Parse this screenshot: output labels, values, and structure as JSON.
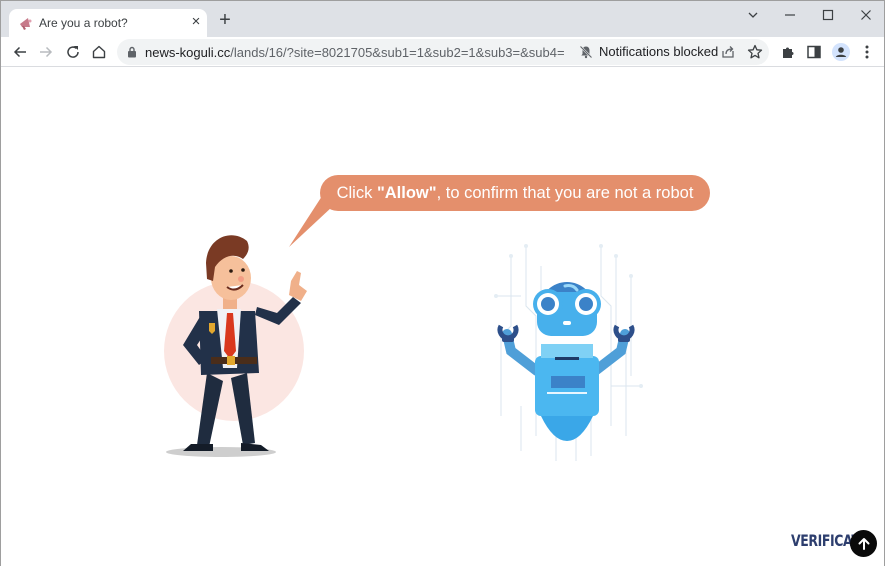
{
  "browser": {
    "tab": {
      "title": "Are you a robot?",
      "favicon": "megaphone-icon",
      "close_label": "×"
    },
    "new_tab_label": "+",
    "window_controls": {
      "tab_search": "⌄",
      "minimize": "—",
      "maximize": "☐",
      "close": "✕"
    },
    "toolbar": {
      "back": "back-arrow-icon",
      "forward": "forward-arrow-icon",
      "reload": "reload-icon",
      "home": "home-icon"
    },
    "omnibox": {
      "security_icon": "lock-icon",
      "url_domain": "news-koguli.cc",
      "url_path": "/lands/16/?site=8021705&sub1=1&sub2=1&sub3=&sub4=",
      "notification_status": "Notifications blocked",
      "notification_icon": "bell-off-icon",
      "share_icon": "share-icon",
      "bookmark_icon": "star-icon"
    },
    "extensions_icon": "puzzle-icon",
    "side_panel_icon": "side-panel-icon",
    "profile_icon": "avatar-icon",
    "menu_icon": "kebab-menu-icon"
  },
  "page": {
    "speech_bubble": {
      "prefix": "Click ",
      "highlight": "\"Allow\"",
      "suffix": ", to confirm that you are not a robot"
    },
    "illustrations": {
      "man": "businessman-pointing",
      "robot": "blue-robot-circuit"
    },
    "footer_brand": "VERIFICATI",
    "scroll_top_icon": "arrow-up-icon",
    "colors": {
      "bubble": "#e48f6c",
      "robot_blue": "#3aa7e8",
      "brand_text": "#2d3e6e"
    }
  }
}
